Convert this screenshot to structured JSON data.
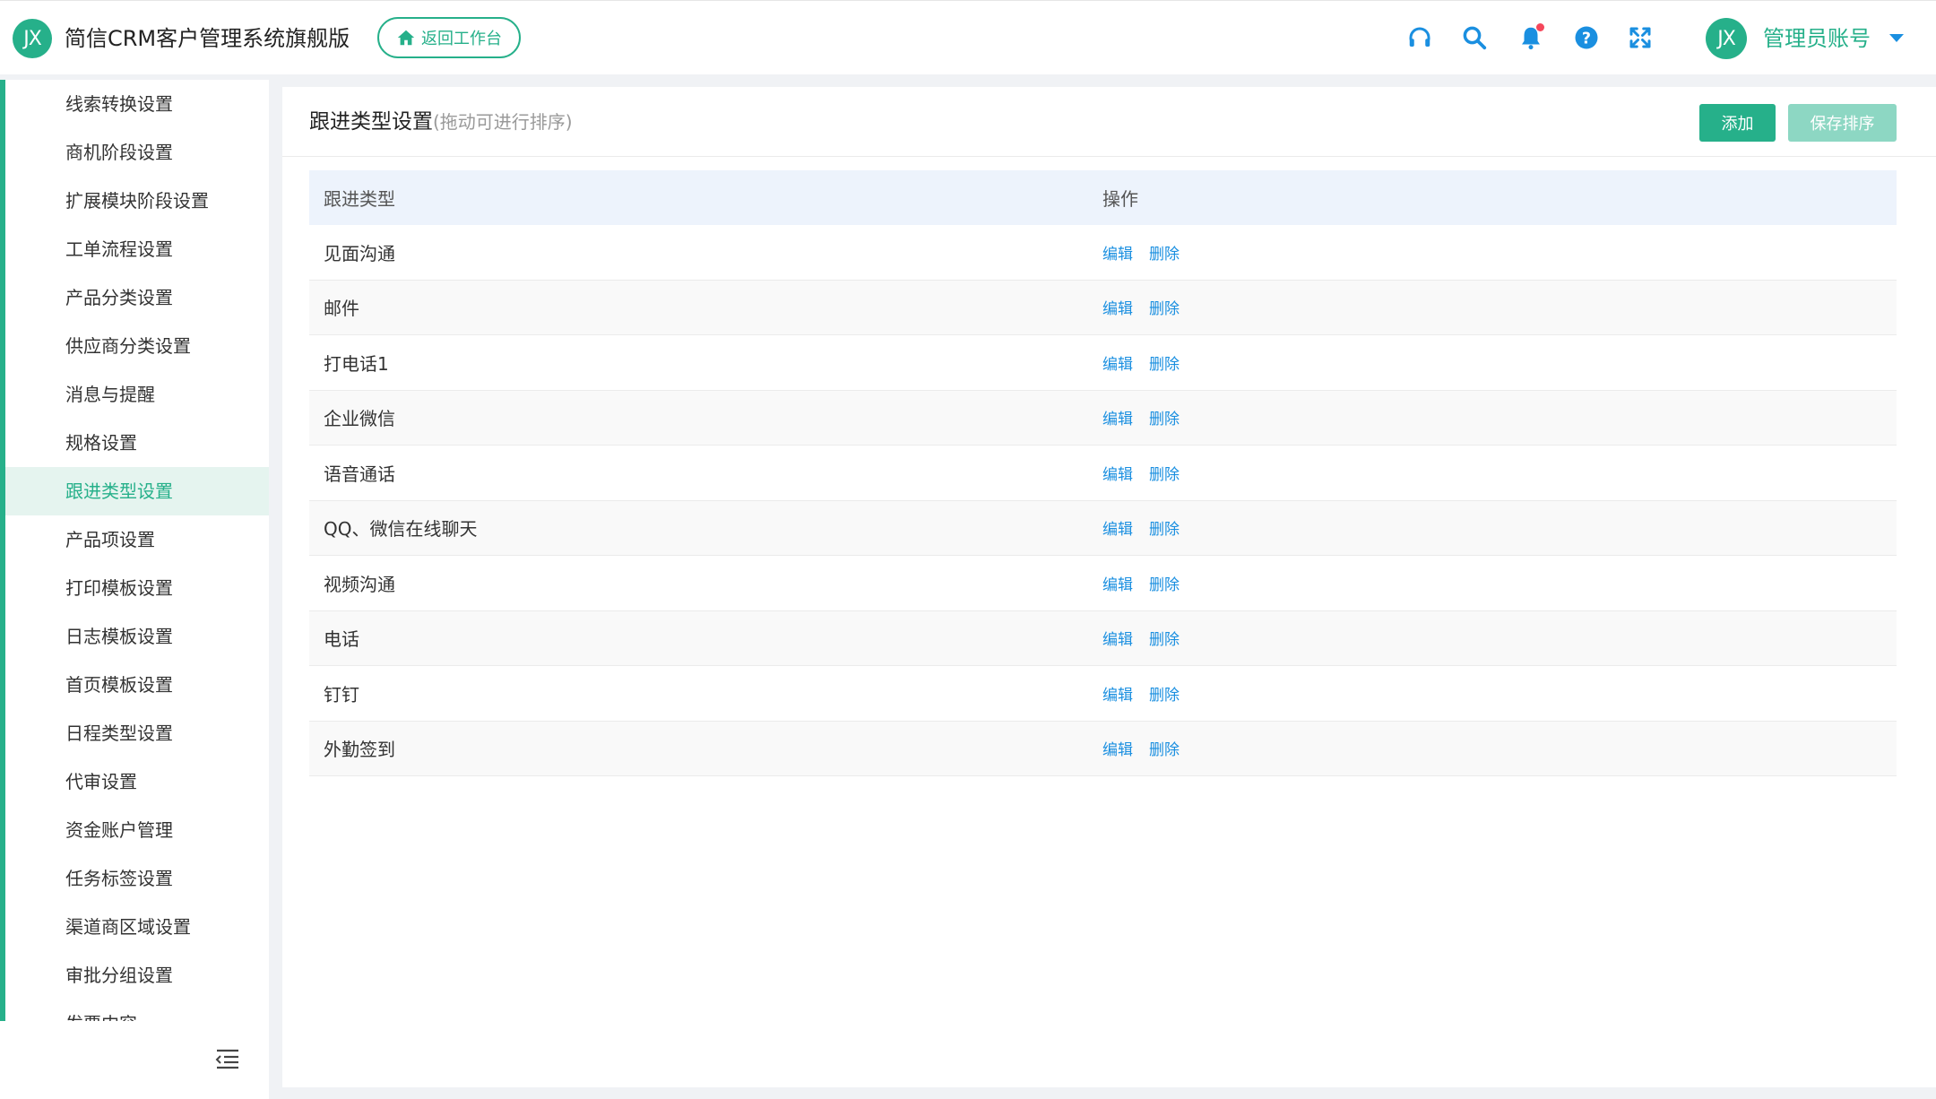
{
  "header": {
    "logo_text": "JX",
    "app_title": "简信CRM客户管理系统旗舰版",
    "back_label": "返回工作台",
    "avatar_text": "JX",
    "user_name": "管理员账号",
    "icons": [
      "headset-icon",
      "search-icon",
      "bell-icon",
      "help-icon",
      "fullscreen-icon"
    ],
    "accent_color": "#26b08a",
    "link_color": "#1a8fe0"
  },
  "sidebar": {
    "items": [
      {
        "label": "线索转换设置"
      },
      {
        "label": "商机阶段设置"
      },
      {
        "label": "扩展模块阶段设置"
      },
      {
        "label": "工单流程设置"
      },
      {
        "label": "产品分类设置"
      },
      {
        "label": "供应商分类设置"
      },
      {
        "label": "消息与提醒"
      },
      {
        "label": "规格设置"
      },
      {
        "label": "跟进类型设置",
        "active": true
      },
      {
        "label": "产品项设置"
      },
      {
        "label": "打印模板设置"
      },
      {
        "label": "日志模板设置"
      },
      {
        "label": "首页模板设置"
      },
      {
        "label": "日程类型设置"
      },
      {
        "label": "代审设置"
      },
      {
        "label": "资金账户管理"
      },
      {
        "label": "任务标签设置"
      },
      {
        "label": "渠道商区域设置"
      },
      {
        "label": "审批分组设置"
      },
      {
        "label": "发票内容"
      }
    ]
  },
  "main": {
    "title": "跟进类型设置",
    "hint": "(拖动可进行排序)",
    "add_label": "添加",
    "save_sort_label": "保存排序",
    "table": {
      "headers": [
        "跟进类型",
        "操作"
      ],
      "edit_label": "编辑",
      "delete_label": "删除",
      "rows": [
        "见面沟通",
        "邮件",
        "打电话1",
        "企业微信",
        "语音通话",
        "QQ、微信在线聊天",
        "视频沟通",
        "电话",
        "钉钉",
        "外勤签到"
      ]
    }
  }
}
